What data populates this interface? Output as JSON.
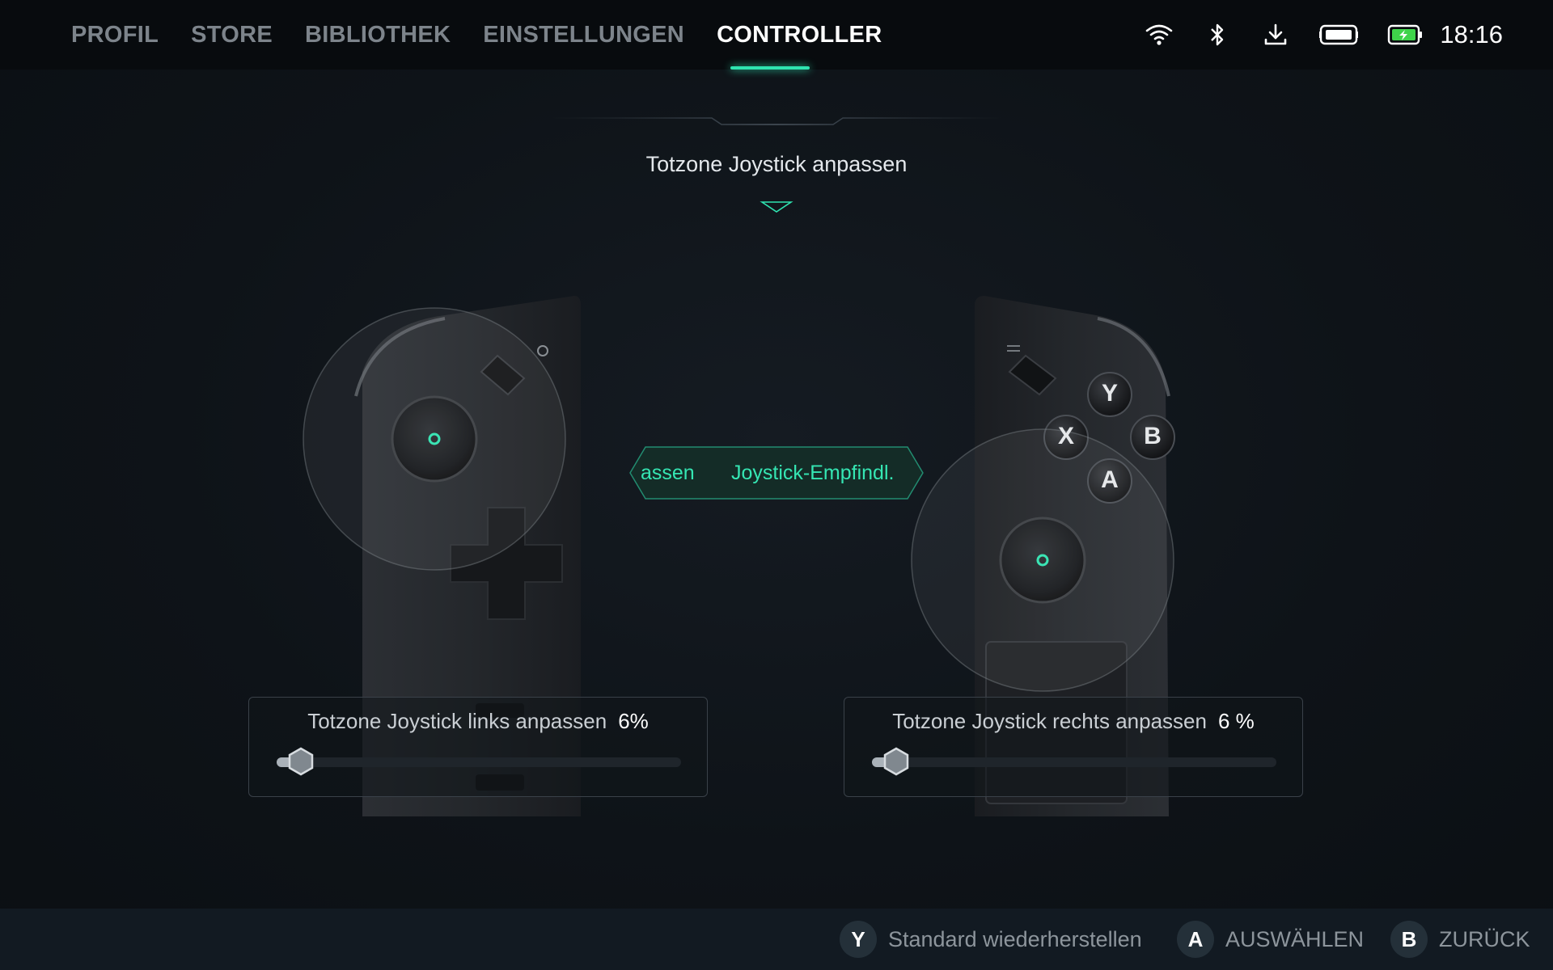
{
  "nav": {
    "items": [
      {
        "label": "PROFIL"
      },
      {
        "label": "STORE"
      },
      {
        "label": "BIBLIOTHEK"
      },
      {
        "label": "EINSTELLUNGEN"
      },
      {
        "label": "CONTROLLER",
        "active": true
      }
    ]
  },
  "status": {
    "icons": [
      "wifi-icon",
      "bluetooth-icon",
      "download-icon",
      "controller-battery-icon",
      "battery-charging-icon"
    ],
    "time": "18:16"
  },
  "heading": "Totzone Joystick anpassen",
  "mode_switch": {
    "left_label": "assen",
    "right_label": "Joystick-Empfindl."
  },
  "controller_right": {
    "buttons": [
      "Y",
      "X",
      "B",
      "A"
    ]
  },
  "sliders": {
    "left": {
      "label": "Totzone Joystick links anpassen",
      "value_text": "6%",
      "value": 6
    },
    "right": {
      "label": "Totzone Joystick rechts anpassen",
      "value_text": "6 %",
      "value": 6
    }
  },
  "footer": {
    "hints": [
      {
        "key": "Y",
        "label": "Standard wiederherstellen"
      },
      {
        "key": "A",
        "label": "AUSWÄHLEN"
      },
      {
        "key": "B",
        "label": "ZURÜCK"
      }
    ]
  },
  "colors": {
    "accent": "#2fe3b0",
    "background": "#0e1318",
    "topbar": "#080b0e",
    "bottombar": "#121a22"
  }
}
